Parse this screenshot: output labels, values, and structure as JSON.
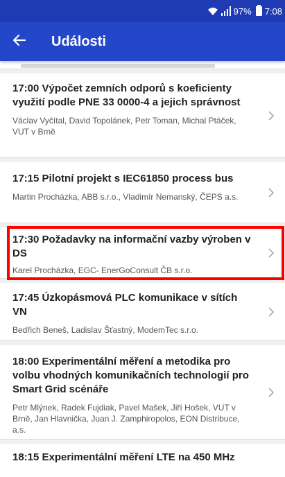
{
  "status_bar": {
    "battery_percent": "97%",
    "time": "7:08",
    "icons": [
      "wifi-icon",
      "signal-icon",
      "battery-icon"
    ]
  },
  "app_bar": {
    "title": "Události",
    "back_icon": "arrow-back-icon"
  },
  "colors": {
    "status_bar": "#1f3bb3",
    "app_bar": "#2446c8",
    "highlight": "#ff0000"
  },
  "events": [
    {
      "title": "17:00 Výpočet zemních odporů s koeficienty využití podle PNE 33 0000-4 a jejich správnost",
      "authors": "Václav Vyčítal, David Topolánek, Petr Toman, Michal Ptáček, VUT v Brně"
    },
    {
      "title": "17:15 Pilotní projekt s IEC61850 process bus",
      "authors": "Martin Procházka, ABB s.r.o., Vladimír Nemanský, ČEPS a.s."
    },
    {
      "title": "17:30 Požadavky na informační vazby výroben v DS",
      "authors": "Karel Procházka, EGC- EnerGoConsult ČB s.r.o."
    },
    {
      "title": "17:45 Úzkopásmová PLC komunikace v sítích VN",
      "authors": "Bedřich Beneš, Ladislav Šťastný, ModemTec s.r.o."
    },
    {
      "title": "18:00 Experimentální měření a metodika pro volbu vhodných komunikačních technologií pro Smart Grid scénáře",
      "authors": "Petr Mlýnek, Radek Fujdiak, Pavel Mašek, Jiří Hošek, VUT v Brně, Jan Hlavnička, Juan J. Zamphiropolos, EON Distribuce, a.s."
    },
    {
      "title": "18:15 Experimentální měření LTE na 450 MHz",
      "authors": ""
    }
  ]
}
